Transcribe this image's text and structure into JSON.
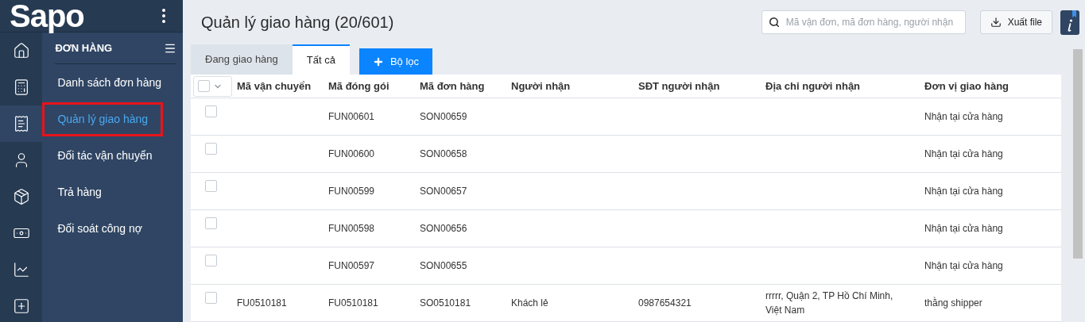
{
  "logo": "Sapo",
  "nav_rail": [
    {
      "selected": false
    },
    {
      "selected": false
    },
    {
      "selected": true
    },
    {
      "selected": false
    },
    {
      "selected": false
    },
    {
      "selected": false
    },
    {
      "selected": false
    },
    {
      "selected": false
    }
  ],
  "sidebar": {
    "heading": "ĐƠN HÀNG",
    "items": [
      {
        "label": "Danh sách đơn hàng",
        "selected": false,
        "annotated": false
      },
      {
        "label": "Quản lý giao hàng",
        "selected": true,
        "annotated": true
      },
      {
        "label": "Đối tác vận chuyển",
        "selected": false,
        "annotated": false
      },
      {
        "label": "Trả hàng",
        "selected": false,
        "annotated": false
      },
      {
        "label": "Đối soát công nợ",
        "selected": false,
        "annotated": false
      }
    ]
  },
  "page_title": "Quản lý giao hàng (20/601)",
  "search": {
    "placeholder": "Mã vận đơn, mã đơn hàng, người nhận"
  },
  "export_button": "Xuất file",
  "tabs": [
    {
      "label": "Đang giao hàng",
      "selected": false
    },
    {
      "label": "Tất cả",
      "selected": true
    }
  ],
  "filter_button": "Bộ lọc",
  "table": {
    "select_all_checked": false,
    "columns": [
      "Mã vận chuyển",
      "Mã đóng gói",
      "Mã đơn hàng",
      "Người nhận",
      "SĐT người nhận",
      "Địa chỉ người nhận",
      "Đơn vị giao hàng"
    ],
    "rows": [
      {
        "checked": false,
        "cells": [
          "",
          "FUN00601",
          "SON00659",
          "",
          "",
          "",
          "Nhận tại cửa hàng"
        ]
      },
      {
        "checked": false,
        "cells": [
          "",
          "FUN00600",
          "SON00658",
          "",
          "",
          "",
          "Nhận tại cửa hàng"
        ]
      },
      {
        "checked": false,
        "cells": [
          "",
          "FUN00599",
          "SON00657",
          "",
          "",
          "",
          "Nhận tại cửa hàng"
        ]
      },
      {
        "checked": false,
        "cells": [
          "",
          "FUN00598",
          "SON00656",
          "",
          "",
          "",
          "Nhận tại cửa hàng"
        ]
      },
      {
        "checked": false,
        "cells": [
          "",
          "FUN00597",
          "SON00655",
          "",
          "",
          "",
          "Nhận tại cửa hàng"
        ]
      },
      {
        "checked": false,
        "cells": [
          "FU0510181",
          "FU0510181",
          "SO0510181",
          "Khách lẻ",
          "0987654321",
          "rrrrr, Quận 2, TP Hồ Chí Minh, Việt Nam",
          "thằng shipper"
        ]
      }
    ]
  }
}
